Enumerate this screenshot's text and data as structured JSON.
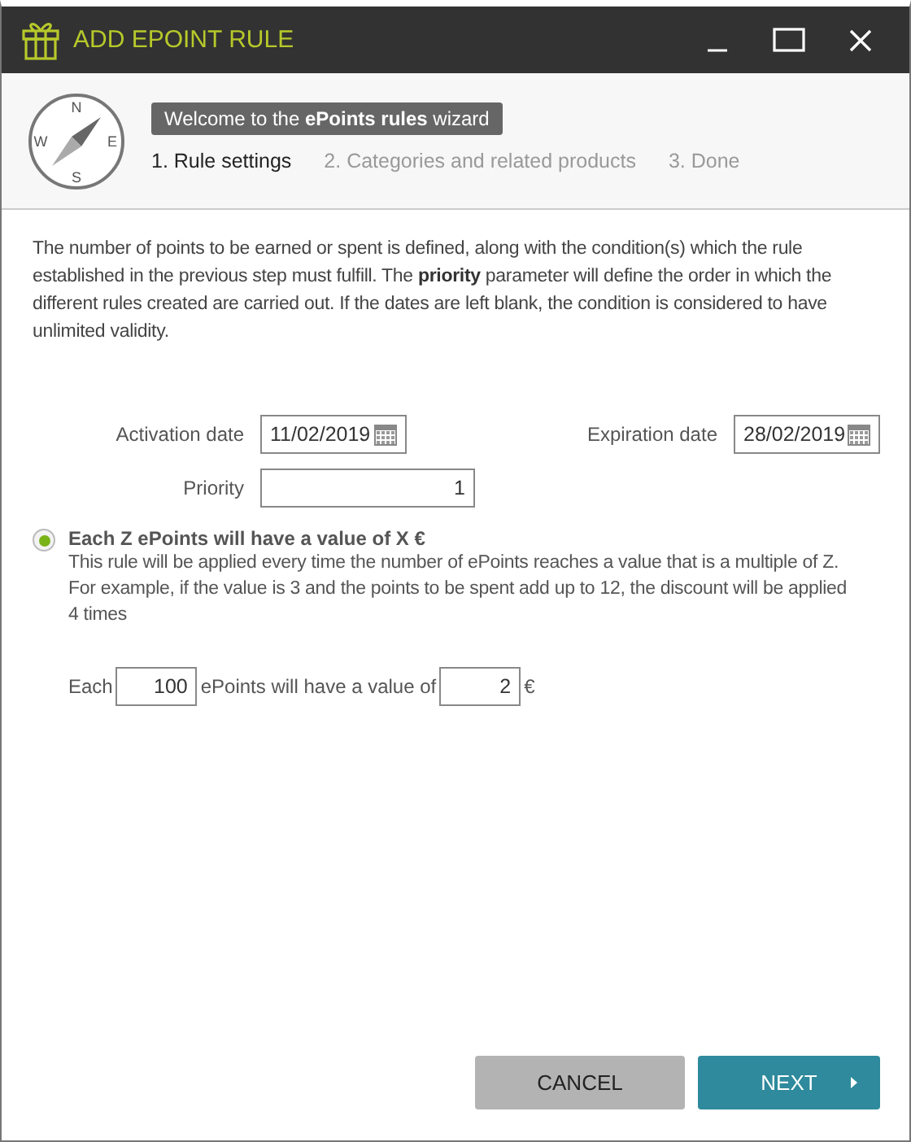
{
  "window": {
    "title": "ADD EPOINT RULE"
  },
  "compass": {
    "north": "N",
    "east": "E",
    "south": "S",
    "west": "W"
  },
  "wizard": {
    "welcome": "Welcome to the **ePoints rules** wizard",
    "steps": [
      {
        "label": "1. Rule settings",
        "selected": true
      },
      {
        "label": "2. Categories and related products",
        "selected": false
      },
      {
        "label": "3. Done",
        "selected": false
      }
    ]
  },
  "description": "The number of points to be earned or spent is defined, along with the condition(s) which the rule established in the previous step must fulfill. The **priority** parameter will define the order in which the different rules created are carried out. If the dates are left blank, the condition is considered to have unlimited validity.",
  "activation_date": {
    "label": "Activation date",
    "value": "11/02/2019"
  },
  "expiration_date": {
    "label": "Expiration date",
    "value": "28/02/2019"
  },
  "priority": {
    "label": "Priority",
    "value": "1"
  },
  "option": {
    "label": "Each Z ePoints will have a value of X €",
    "selected": true,
    "description": "This rule will be applied every time the number of ePoints reaches a value that is a multiple of Z. For example, if the value is 3 and the points to be spent add up to 12, the discount will be applied 4 times",
    "sentence": {
      "prefix": "Each",
      "points": "100",
      "middle": "ePoints will have a value of",
      "amount": "2",
      "suffix": "€"
    }
  },
  "buttons": {
    "cancel": "CANCEL",
    "next": "NEXT"
  }
}
